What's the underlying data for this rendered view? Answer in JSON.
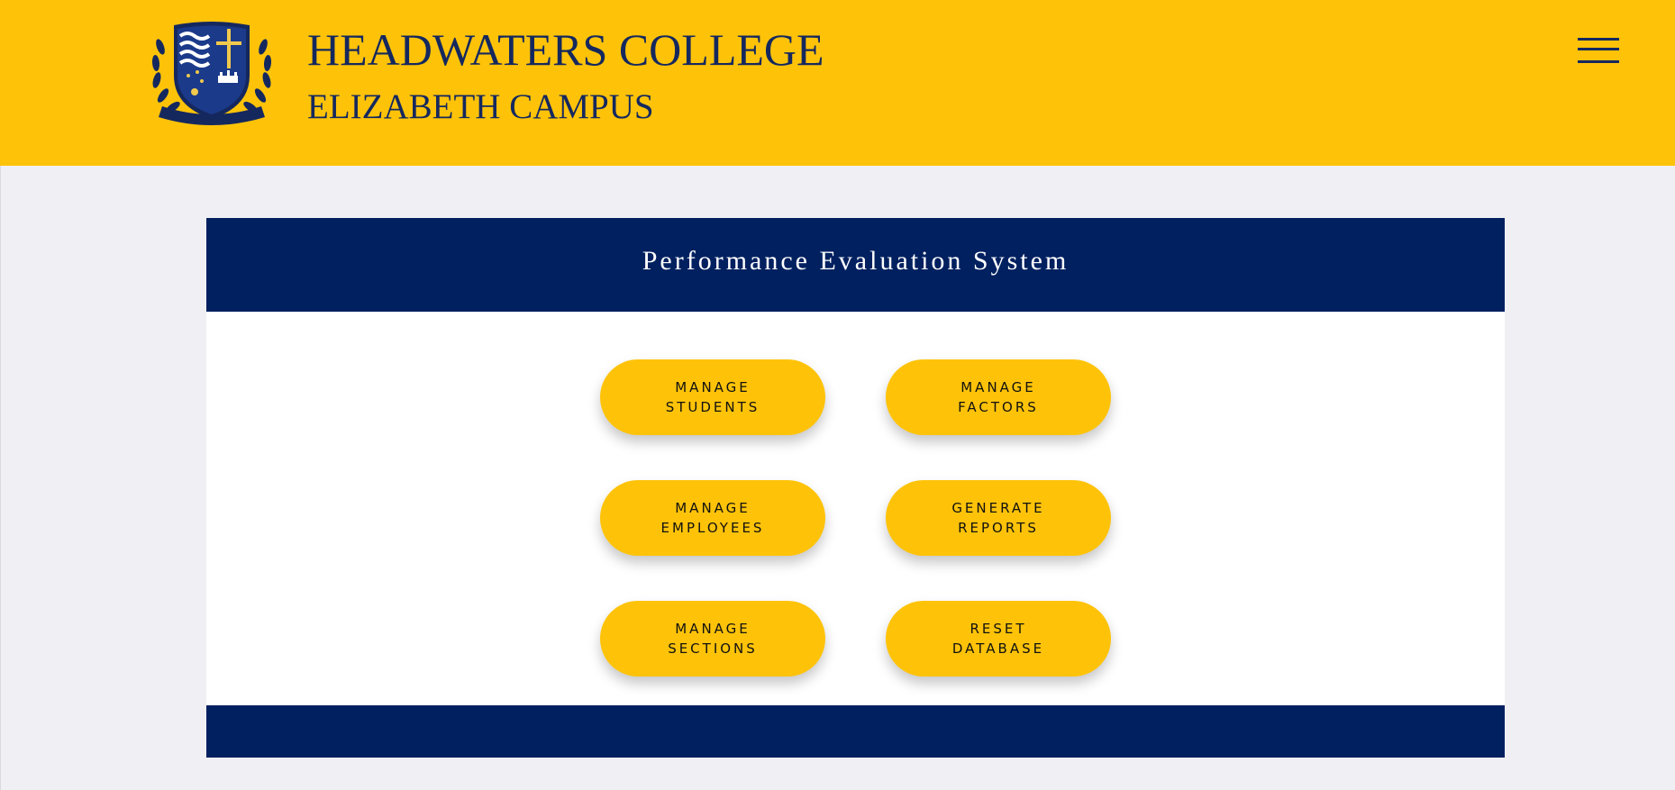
{
  "header": {
    "college_name": "HEADWATERS COLLEGE",
    "campus_name": "ELIZABETH CAMPUS",
    "crest_banner_text": "HEADWATERS COLLEGE",
    "menu_icon": "hamburger-menu-icon"
  },
  "panel": {
    "title": "Performance Evaluation System",
    "buttons": [
      {
        "label": "MANAGE STUDENTS"
      },
      {
        "label": "MANAGE FACTORS"
      },
      {
        "label": "MANAGE EMPLOYEES"
      },
      {
        "label": "GENERATE REPORTS"
      },
      {
        "label": "MANAGE SECTIONS"
      },
      {
        "label": "RESET DATABASE"
      }
    ]
  },
  "colors": {
    "header_background": "#fec309",
    "navy": "#00205f",
    "heading_text": "#15285e",
    "page_background": "#efeff4",
    "button_background": "#fec309"
  }
}
